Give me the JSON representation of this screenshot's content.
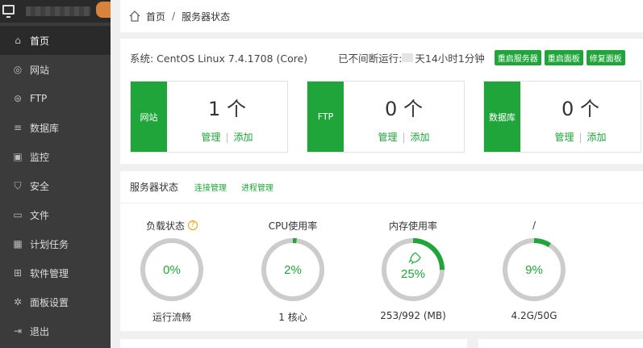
{
  "sidebar": {
    "items": [
      {
        "label": "首页",
        "icon": "home-icon",
        "active": true
      },
      {
        "label": "网站",
        "icon": "globe-icon"
      },
      {
        "label": "FTP",
        "icon": "ftp-icon"
      },
      {
        "label": "数据库",
        "icon": "database-icon"
      },
      {
        "label": "监控",
        "icon": "monitor-icon"
      },
      {
        "label": "安全",
        "icon": "shield-icon"
      },
      {
        "label": "文件",
        "icon": "folder-icon"
      },
      {
        "label": "计划任务",
        "icon": "calendar-icon"
      },
      {
        "label": "软件管理",
        "icon": "apps-icon"
      },
      {
        "label": "面板设置",
        "icon": "gear-icon"
      },
      {
        "label": "退出",
        "icon": "logout-icon"
      }
    ]
  },
  "breadcrumb": {
    "home": "首页",
    "sep": "/",
    "current": "服务器状态"
  },
  "system": {
    "os": "系统: CentOS Linux 7.4.1708 (Core)",
    "uptime_label": "已不间断运行:",
    "uptime_value": "天14小时1分钟",
    "buttons": [
      "重启服务器",
      "重启面板",
      "修复面板"
    ]
  },
  "stats": [
    {
      "label": "网站",
      "count": "1 个",
      "manage": "管理",
      "sep": "|",
      "add": "添加"
    },
    {
      "label": "FTP",
      "count": "0 个",
      "manage": "管理",
      "sep": "|",
      "add": "添加"
    },
    {
      "label": "数据库",
      "count": "0 个",
      "manage": "管理",
      "sep": "|",
      "add": "添加"
    }
  ],
  "status": {
    "title": "服务器状态",
    "tabs": [
      "连接管理",
      "进程管理"
    ],
    "gauges": [
      {
        "title": "负载状态",
        "help": "?",
        "value": "0%",
        "percent": 0,
        "sub": "运行流畅",
        "icon": ""
      },
      {
        "title": "CPU使用率",
        "value": "2%",
        "percent": 2,
        "sub": "1 核心",
        "icon": ""
      },
      {
        "title": "内存使用率",
        "value": "25%",
        "percent": 25,
        "sub": "253/992 (MB)",
        "icon": "rocket-icon"
      },
      {
        "title": "/",
        "value": "9%",
        "percent": 9,
        "sub": "4.2G/50G",
        "icon": ""
      }
    ]
  },
  "colors": {
    "accent": "#20a53a",
    "sidebar": "#3b3b3b",
    "track": "#cccccc"
  }
}
